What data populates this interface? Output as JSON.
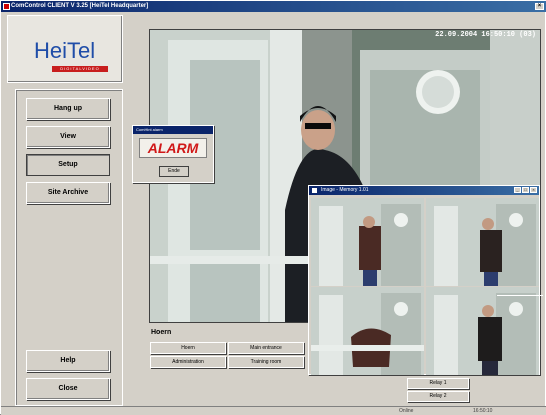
{
  "window": {
    "title": "ComControl CLIENT  V 3.25 [HeiTel Headquarter]"
  },
  "logo": {
    "name": "HeiTel",
    "tagline": "DIGITALVIDEO"
  },
  "menu": {
    "hang_up": "Hang up",
    "view": "View",
    "setup": "Setup",
    "site_archive": "Site Archive",
    "help": "Help",
    "close": "Close"
  },
  "video": {
    "timestamp": "22.09.2004  16:50:10  (03)"
  },
  "cameras": {
    "site_name": "Hoern",
    "buttons": [
      "Hoern",
      "Main entrance",
      "Administration",
      "Training room"
    ]
  },
  "relays": [
    "Relay 1",
    "Relay 2"
  ],
  "alarm": {
    "title": "ComHint alarm",
    "text": "ALARM",
    "button": "Ende"
  },
  "memory_window": {
    "title": "Image - Memory 1.01"
  },
  "status": {
    "online": "Online",
    "time": "16:50:10"
  },
  "colors": {
    "titlebar": "#0a246a",
    "alarm_red": "#d01818",
    "logo_blue": "#1f4da8"
  }
}
